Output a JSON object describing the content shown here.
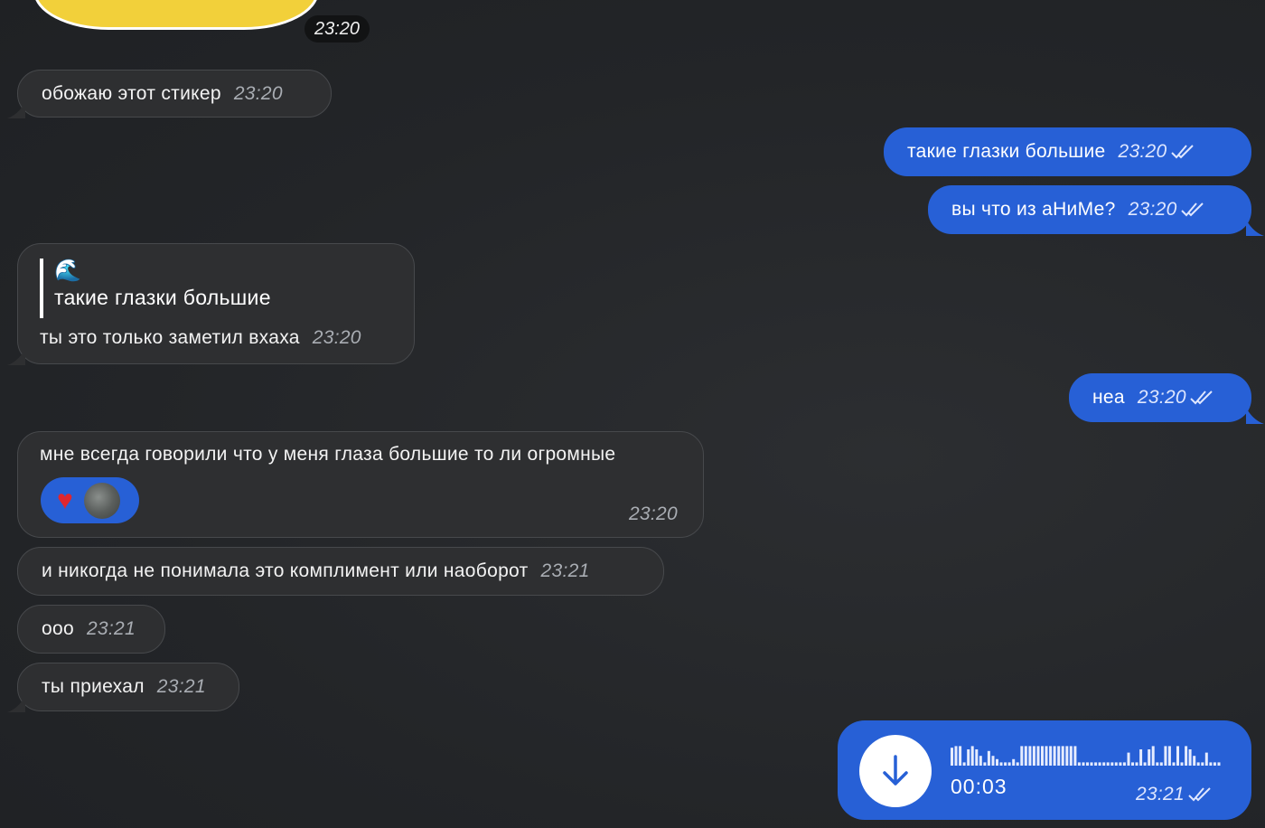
{
  "sticker": {
    "time": "23:20"
  },
  "messages": {
    "m1": {
      "text": "обожаю этот стикер",
      "time": "23:20"
    },
    "m2": {
      "text": "такие глазки большие",
      "time": "23:20"
    },
    "m3": {
      "text": "вы что из аНиМе?",
      "time": "23:20"
    },
    "m4": {
      "quote_emoji": "🌊",
      "quote_text": "такие глазки большие",
      "text": "ты это только заметил вхаха",
      "time": "23:20"
    },
    "m5": {
      "text": "неа",
      "time": "23:20"
    },
    "m6": {
      "text": "мне всегда говорили что у меня глаза большие то ли огромные",
      "time": "23:20",
      "reaction": "♥"
    },
    "m7": {
      "text": "и никогда не понимала это комплимент или наоборот",
      "time": "23:21"
    },
    "m8": {
      "text": "ооо",
      "time": "23:21"
    },
    "m9": {
      "text": "ты приехал",
      "time": "23:21"
    }
  },
  "voice": {
    "duration": "00:03",
    "time": "23:21",
    "waveform": [
      0.55,
      0.6,
      0.6,
      0.1,
      0.5,
      0.6,
      0.5,
      0.3,
      0.1,
      0.45,
      0.3,
      0.2,
      0.1,
      0.1,
      0.1,
      0.2,
      0.1,
      0.6,
      0.6,
      0.6,
      0.6,
      0.6,
      0.6,
      0.6,
      0.6,
      0.6,
      0.6,
      0.6,
      0.6,
      0.6,
      0.6,
      0.1,
      0.1,
      0.1,
      0.1,
      0.1,
      0.1,
      0.1,
      0.1,
      0.1,
      0.1,
      0.1,
      0.1,
      0.4,
      0.1,
      0.1,
      0.5,
      0.1,
      0.5,
      0.6,
      0.1,
      0.1,
      0.6,
      0.6,
      0.1,
      0.6,
      0.1,
      0.6,
      0.5,
      0.3,
      0.1,
      0.1,
      0.4,
      0.1,
      0.1,
      0.1
    ]
  },
  "colors": {
    "background": "#26282b",
    "incoming": "#2e2f31",
    "outgoing": "#2760d6"
  }
}
